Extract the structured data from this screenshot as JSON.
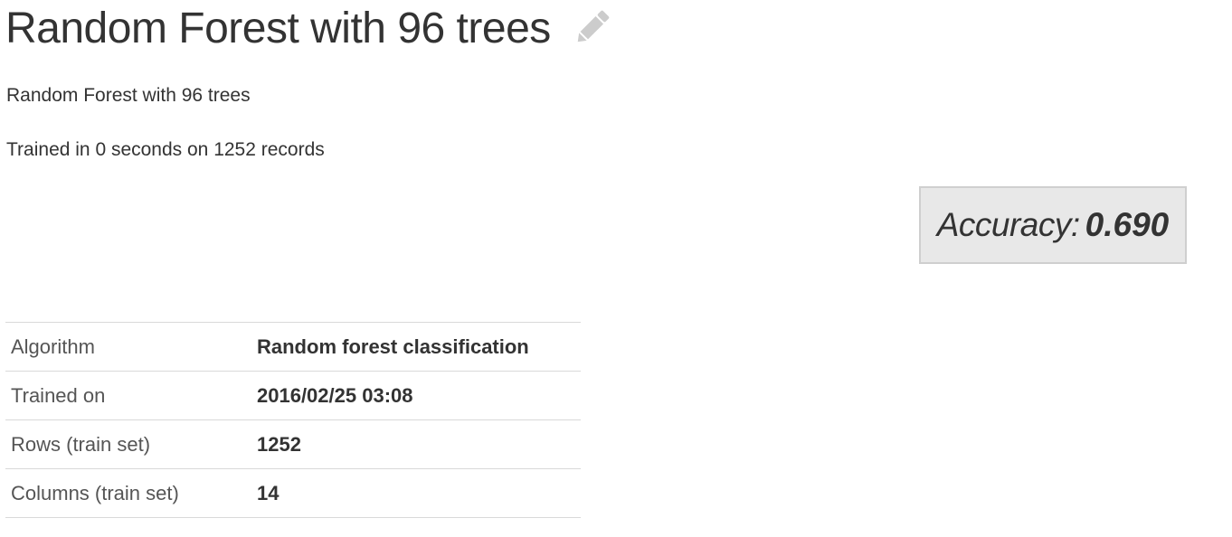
{
  "header": {
    "title": "Random Forest with 96 trees",
    "edit_icon": "pencil-icon"
  },
  "summary": {
    "description": "Random Forest with 96 trees",
    "training_info": "Trained in 0 seconds on 1252 records"
  },
  "metric": {
    "label": "Accuracy:",
    "value": "0.690"
  },
  "details": {
    "rows": [
      {
        "key": "Algorithm",
        "value": "Random forest classification"
      },
      {
        "key": "Trained on",
        "value": "2016/02/25 03:08"
      },
      {
        "key": "Rows (train set)",
        "value": "1252"
      },
      {
        "key": "Columns (train set)",
        "value": "14"
      }
    ]
  },
  "colors": {
    "text": "#333333",
    "icon": "#cccccc",
    "metric_background": "#e8e8e8",
    "metric_border": "#cfcfcf",
    "divider": "#d9d9d9"
  }
}
